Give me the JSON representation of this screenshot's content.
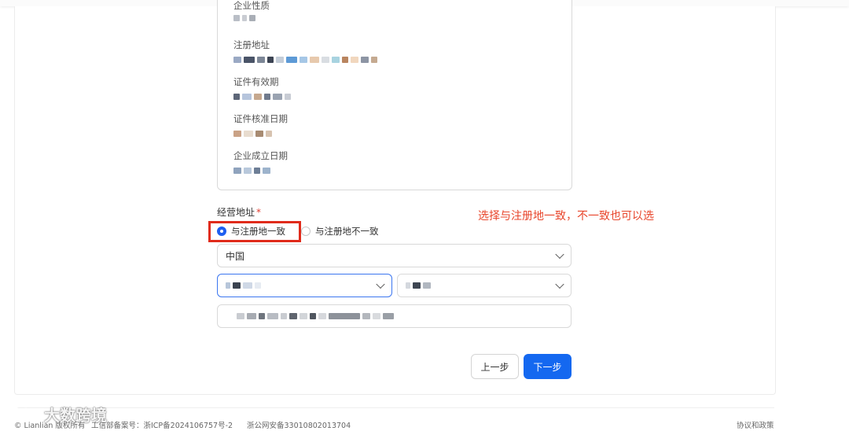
{
  "info_fields": [
    {
      "label": "企业性质"
    },
    {
      "label": "注册地址"
    },
    {
      "label": "证件有效期"
    },
    {
      "label": "证件核准日期"
    },
    {
      "label": "企业成立日期"
    }
  ],
  "operating_address": {
    "label": "经营地址",
    "required_mark": "*",
    "annotation": "选择与注册地一致，不一致也可以选",
    "options": [
      {
        "label": "与注册地一致",
        "selected": true
      },
      {
        "label": "与注册地不一致",
        "selected": false
      }
    ],
    "country": "中国"
  },
  "buttons": {
    "prev": "上一步",
    "next": "下一步"
  },
  "footer": {
    "copyright": "© Lianlian 版权所有",
    "icp": "工信部备案号：浙ICP备2024106757号-2",
    "police": "浙公网安备33010802013704",
    "policy_link": "协议和政策"
  },
  "watermark": {
    "text": "大数跨境"
  },
  "colors": {
    "primary": "#1468f0",
    "highlight_box": "#e02b1b",
    "annotation": "#e8452b"
  }
}
